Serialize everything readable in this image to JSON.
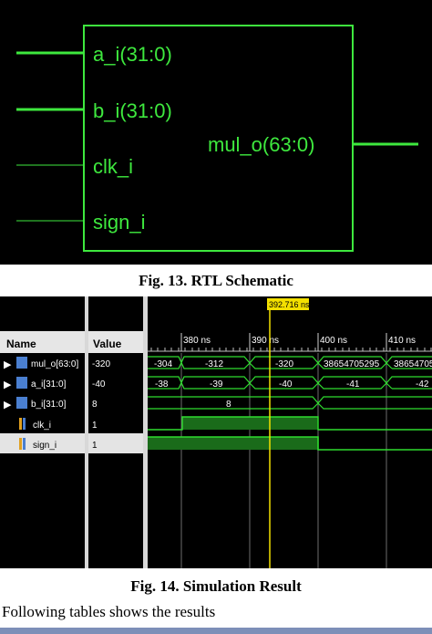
{
  "fig13": {
    "inputs": [
      "a_i(31:0)",
      "b_i(31:0)",
      "clk_i",
      "sign_i"
    ],
    "output": "mul_o(63:0)",
    "wire_color": "#3ee83e",
    "caption": "Fig. 13. RTL Schematic"
  },
  "fig14": {
    "cursor_label": "392.716 ns",
    "columns": [
      "Name",
      "Value"
    ],
    "time_labels": [
      "380 ns",
      "390 ns",
      "400 ns",
      "410 ns"
    ],
    "signals": [
      {
        "name": "mul_o[63:0]",
        "value": "-320",
        "icon": "bus-icon",
        "expandable": true,
        "segments": [
          "-304",
          "-312",
          "-320",
          "38654705295",
          "38654705"
        ]
      },
      {
        "name": "a_i[31:0]",
        "value": "-40",
        "icon": "bus-icon",
        "expandable": true,
        "segments": [
          "-38",
          "-39",
          "-40",
          "-41",
          "-42"
        ]
      },
      {
        "name": "b_i[31:0]",
        "value": "8",
        "icon": "bus-icon",
        "expandable": true,
        "segments": [
          "8"
        ]
      },
      {
        "name": "clk_i",
        "value": "1",
        "icon": "bit-icon",
        "expandable": false
      },
      {
        "name": "sign_i",
        "value": "1",
        "icon": "bit-icon",
        "expandable": false
      }
    ],
    "caption": "Fig. 14. Simulation Result",
    "cursor_color": "#f3e000",
    "wave_color": "#2fdc2f"
  },
  "following_text": "Following tables shows the results"
}
